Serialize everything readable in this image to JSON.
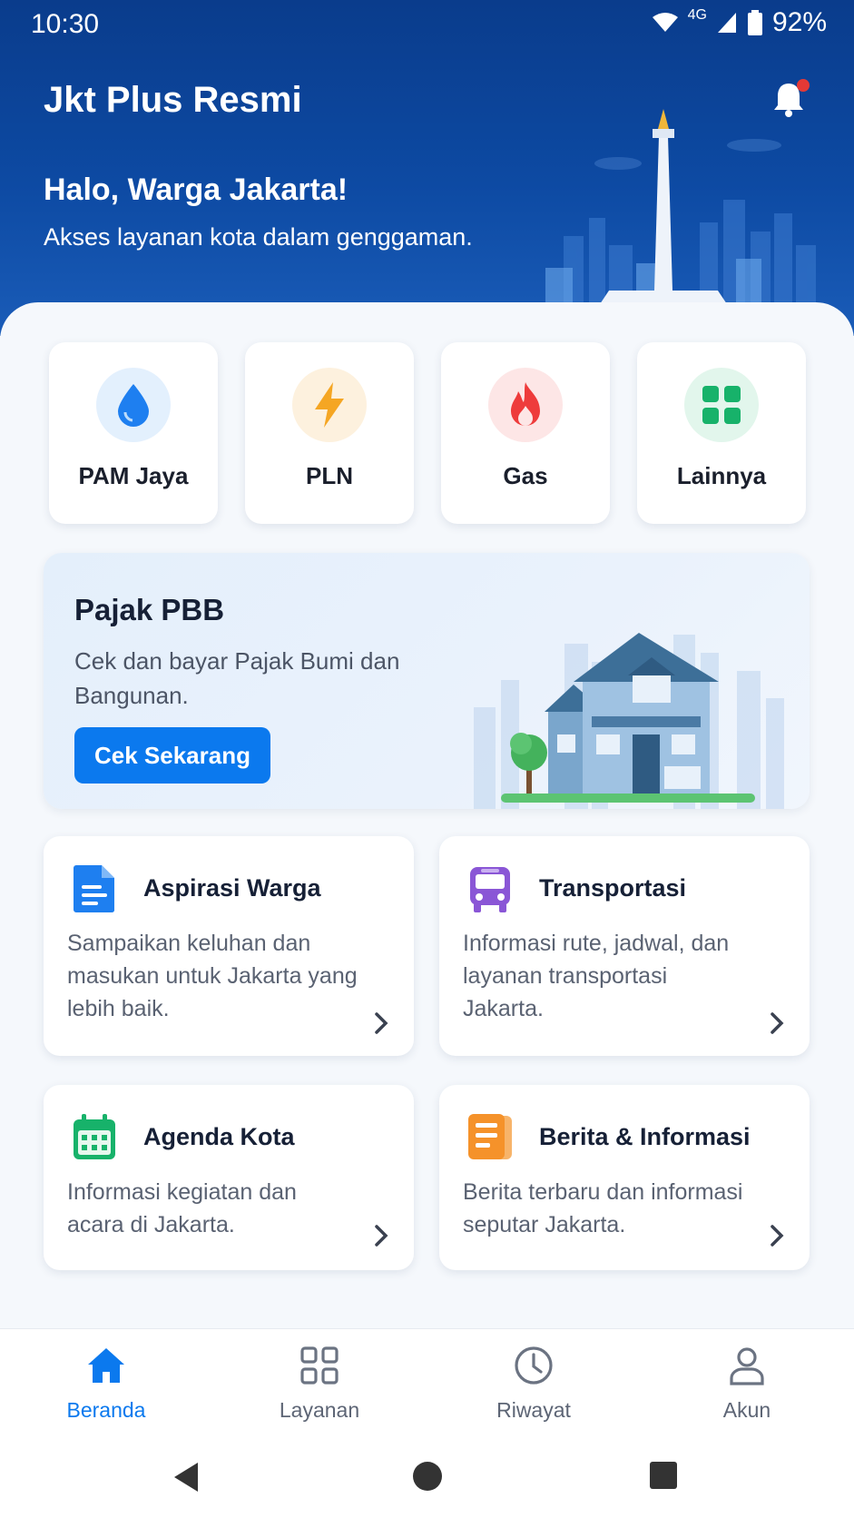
{
  "status": {
    "time": "10:30",
    "network": "4G",
    "battery": "92%"
  },
  "header": {
    "title": "Jkt Plus Resmi",
    "greeting": "Halo, Warga Jakarta!",
    "subtitle": "Akses layanan kota dalam genggaman."
  },
  "quick_services": [
    {
      "label": "PAM Jaya",
      "icon": "water-drop-icon",
      "color": "#1e7ff0",
      "bg": "#e3f0fd"
    },
    {
      "label": "PLN",
      "icon": "lightning-icon",
      "color": "#f5a623",
      "bg": "#fdf1de"
    },
    {
      "label": "Gas",
      "icon": "flame-icon",
      "color": "#ee3b3b",
      "bg": "#fde6e6"
    },
    {
      "label": "Lainnya",
      "icon": "grid-icon",
      "color": "#17b26a",
      "bg": "#e2f6ec"
    }
  ],
  "banner": {
    "title": "Pajak PBB",
    "subtitle": "Cek dan bayar Pajak Bumi dan Bangunan.",
    "button": "Cek Sekarang"
  },
  "cards": [
    {
      "title": "Aspirasi Warga",
      "desc": "Sampaikan keluhan dan masukan untuk Jakarta yang lebih baik.",
      "icon": "document-icon",
      "color": "#1e7ff0"
    },
    {
      "title": "Transportasi",
      "desc": "Informasi rute, jadwal, dan layanan transportasi Jakarta.",
      "icon": "bus-icon",
      "color": "#8a56d6"
    },
    {
      "title": "Agenda Kota",
      "desc": "Informasi kegiatan dan acara di Jakarta.",
      "icon": "calendar-icon",
      "color": "#17b26a"
    },
    {
      "title": "Berita & Informasi",
      "desc": "Berita terbaru dan informasi seputar Jakarta.",
      "icon": "news-icon",
      "color": "#f5922a"
    }
  ],
  "bottom_nav": [
    {
      "label": "Beranda",
      "icon": "home-icon",
      "active": true
    },
    {
      "label": "Layanan",
      "icon": "grid-outline-icon",
      "active": false
    },
    {
      "label": "Riwayat",
      "icon": "clock-icon",
      "active": false
    },
    {
      "label": "Akun",
      "icon": "person-icon",
      "active": false
    }
  ],
  "colors": {
    "primary": "#0b79ee",
    "header": "#0d4aa3",
    "notification_dot": "#e53935"
  }
}
